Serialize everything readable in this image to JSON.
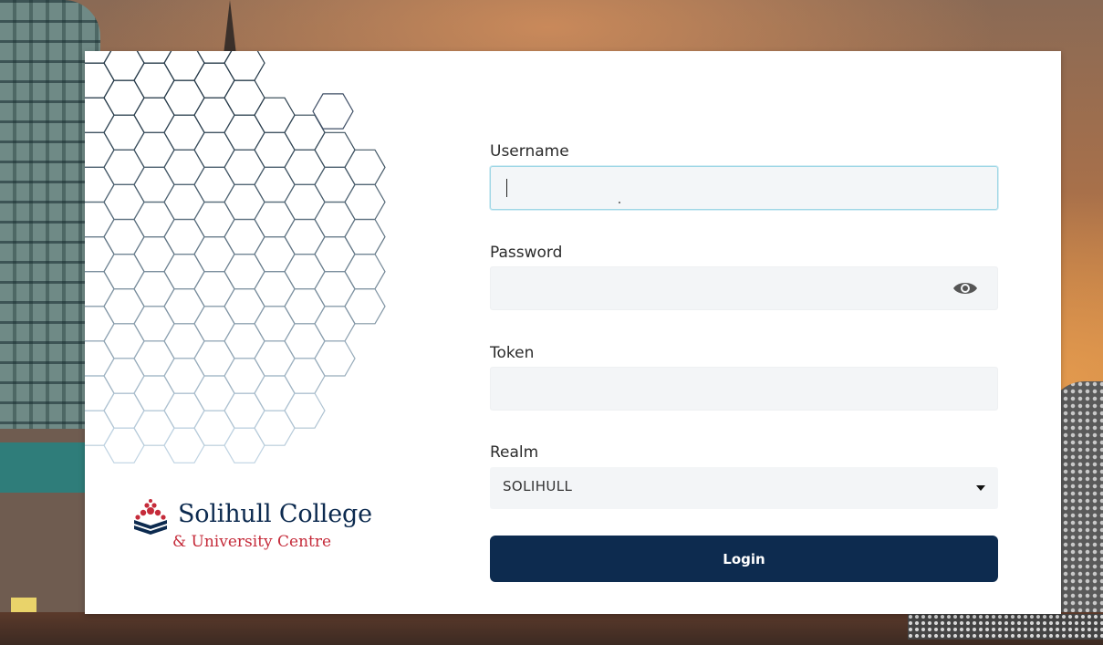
{
  "brand": {
    "name": "Solihull College",
    "subtitle": "& University Centre",
    "colors": {
      "navy": "#0d2b4f",
      "red": "#c52b3a"
    }
  },
  "form": {
    "username": {
      "label": "Username",
      "value": "",
      "state": "focused"
    },
    "password": {
      "label": "Password",
      "value": "",
      "toggle_icon": "eye-icon"
    },
    "token": {
      "label": "Token",
      "value": ""
    },
    "realm": {
      "label": "Realm",
      "selected": "SOLIHULL"
    },
    "login": {
      "label": "Login"
    }
  }
}
